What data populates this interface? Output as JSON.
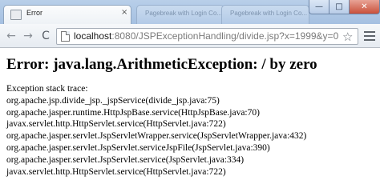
{
  "browser": {
    "tab_title": "Error",
    "tab_close": "×",
    "ghost_tabs": [
      "Pagebreak with Login Co...",
      "Pagebreak with Login Co..."
    ],
    "window_buttons": {
      "minimize": "—",
      "maximize": "□",
      "close": "✕"
    }
  },
  "toolbar": {
    "back": "←",
    "forward": "→",
    "reload": "C",
    "url_host": "localhost",
    "url_path": ":8080/JSPExceptionHandling/divide.jsp?x=1999&y=0",
    "star": "☆"
  },
  "content": {
    "error_title": "Error: java.lang.ArithmeticException: / by zero",
    "trace_heading": "Exception stack trace:",
    "trace_lines": [
      "org.apache.jsp.divide_jsp._jspService(divide_jsp.java:75)",
      "org.apache.jasper.runtime.HttpJspBase.service(HttpJspBase.java:70)",
      "javax.servlet.http.HttpServlet.service(HttpServlet.java:722)",
      "org.apache.jasper.servlet.JspServletWrapper.service(JspServletWrapper.java:432)",
      "org.apache.jasper.servlet.JspServlet.serviceJspFile(JspServlet.java:390)",
      "org.apache.jasper.servlet.JspServlet.service(JspServlet.java:334)",
      "javax.servlet.http.HttpServlet.service(HttpServlet.java:722)"
    ]
  }
}
